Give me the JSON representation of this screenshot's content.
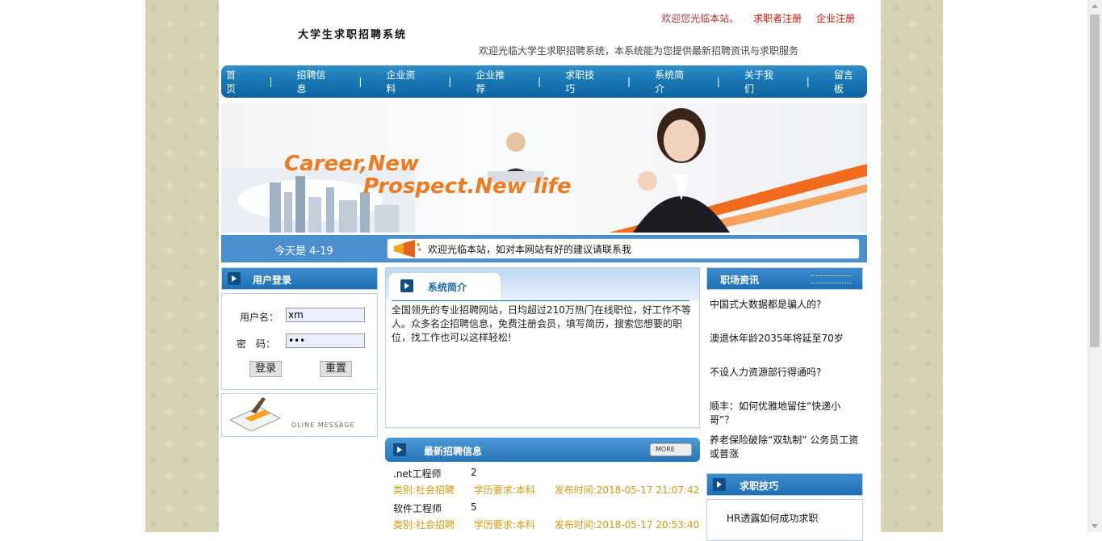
{
  "site": {
    "logo_text": "大学生求职招聘系统",
    "welcome": "欢迎您光临本站。",
    "links": [
      "求职者注册",
      "企业注册"
    ],
    "tagline": "欢迎光临大学生求职招聘系统，本系统能为您提供最新招聘资讯与求职服务"
  },
  "nav": [
    "首页",
    "招聘信息",
    "企业资料",
    "企业推荐",
    "求职技巧",
    "系统简介",
    "关于我们",
    "留言板"
  ],
  "banner": {
    "line1": "Career,New",
    "line2": "Prospect.New life"
  },
  "datebar": {
    "date": "今天是 4-19",
    "notice": "欢迎光临本站，如对本网站有好的建议请联系我"
  },
  "login": {
    "title": "用户登录",
    "username_label": "用户名：",
    "username_value": "xm",
    "password_label": "密　码：",
    "password_value": "•••",
    "login_btn": "登录",
    "reset_btn": "重置",
    "message_label": "OLINE MESSAGE"
  },
  "intro": {
    "title": "系统简介",
    "body": "全国领先的专业招聘网站，日均超过210万热门在线职位，好工作不等人。众多名企招聘信息，免费注册会员，填写简历，搜索您想要的职位，找工作也可以这样轻松!"
  },
  "jobs": {
    "title": "最新招聘信息",
    "more": "MORE",
    "items": [
      {
        "name": ".net工程师",
        "count": "2",
        "category": "类别:社会招聘",
        "education": "学历要求:本科",
        "time": "发布时间:2018-05-17 21:07:42"
      },
      {
        "name": "软件工程师",
        "count": "5",
        "category": "类别:社会招聘",
        "education": "学历要求:本科",
        "time": "发布时间:2018-05-17 20:53:40"
      }
    ]
  },
  "news": {
    "title": "职场资讯",
    "items": [
      "中国式大数据都是骗人的?",
      "澳退休年龄2035年将延至70岁",
      "不设人力资源部行得通吗?",
      "顺丰：如何优雅地留住“快递小哥”？",
      "养老保险破除“双轨制” 公务员工资或普涨"
    ]
  },
  "tips": {
    "title": "求职技巧",
    "items": [
      "HR透露如何成功求职"
    ]
  },
  "colors": {
    "nav_blue": "#1a78b5",
    "datebar_blue": "#4a90cf",
    "job_meta": "#d69b0a",
    "banner_orange": "#f07a1f",
    "side_bg": "#d7d2b2"
  }
}
